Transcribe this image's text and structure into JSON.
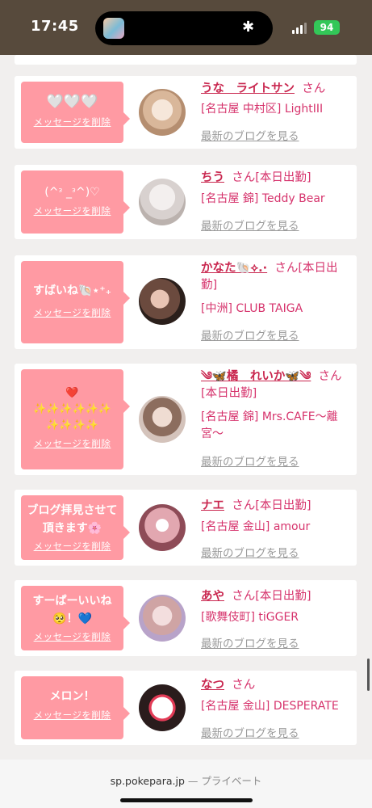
{
  "status_bar": {
    "time": "17:45",
    "battery": "94"
  },
  "browser": {
    "domain": "sp.pokepara.jp",
    "separator": " — ",
    "mode": "プライベート"
  },
  "common": {
    "delete_label": "メッセージを削除",
    "blog_label": "最新のブログを見る"
  },
  "cards": [
    {
      "message": "🤍🤍🤍",
      "name": "うな　ライトサン",
      "san": "さん",
      "status": "",
      "shop": "[名古屋 中村区] LightIII"
    },
    {
      "message": "(^ᵌ _ᵌ^)♡",
      "name": "ちう",
      "san": "さん",
      "status": "[本日出勤]",
      "shop": "[名古屋 錦] Teddy Bear"
    },
    {
      "message": "すばいね🐚⋆⁺₊",
      "name": "かなた🐚⟡.·",
      "san": "さん",
      "status": "[本日出勤]",
      "shop": "[中洲] CLUB TAIGA"
    },
    {
      "message": "❤️\n✨✨✨✨✨✨\n✨✨✨✨",
      "name": "༄🦋橘　れいか🦋༄",
      "san": "さん",
      "status": "[本日出勤]",
      "shop": "[名古屋 錦] Mrs.CAFE〜離宮〜"
    },
    {
      "message": "ブログ拝見させて頂きます🌸",
      "name": "ナエ",
      "san": "さん",
      "status": "[本日出勤]",
      "shop": "[名古屋 金山] amour"
    },
    {
      "message": "すーぱーいいね🥺！💙",
      "name": "あや",
      "san": "さん",
      "status": "[本日出勤]",
      "shop": "[歌舞伎町] tiGGER"
    },
    {
      "message": "メロン！",
      "name": "なつ",
      "san": "さん",
      "status": "",
      "shop": "[名古屋 金山] DESPERATE"
    }
  ]
}
